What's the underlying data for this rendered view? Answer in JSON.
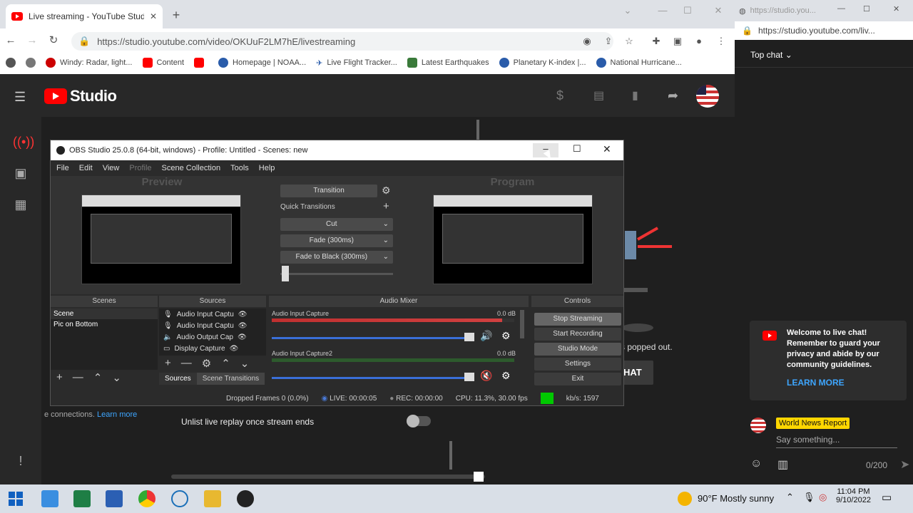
{
  "browser": {
    "tab_title": "Live streaming - YouTube Studio",
    "url": "https://studio.youtube.com/video/OKUuF2LM7hE/livestreaming",
    "bookmarks": [
      {
        "label": "Windy: Radar, light..."
      },
      {
        "label": "Content"
      },
      {
        "label": ""
      },
      {
        "label": "Homepage | NOAA..."
      },
      {
        "label": "Live Flight Tracker..."
      },
      {
        "label": "Latest Earthquakes"
      },
      {
        "label": "Planetary K-index |..."
      },
      {
        "label": "National Hurricane..."
      }
    ]
  },
  "popup": {
    "tab_title": "https://studio.you...",
    "url": "https://studio.youtube.com/liv...",
    "chat_mode": "Top chat",
    "welcome_text": "Welcome to live chat! Remember to guard your privacy and abide by our community guidelines.",
    "learn_more": "LEARN MORE",
    "channel_name": "World News Report",
    "input_placeholder": "Say something...",
    "char_count": "0/200"
  },
  "studio": {
    "logo_text": "Studio",
    "popped_text": "s popped out.",
    "chat_button": "HAT",
    "connections_text": "e connections.",
    "connections_link": "Learn more",
    "unlist_text": "Unlist live replay once stream ends"
  },
  "obs": {
    "title": "OBS Studio 25.0.8 (64-bit, windows) - Profile: Untitled - Scenes: new",
    "menu": [
      "File",
      "Edit",
      "View",
      "Profile",
      "Scene Collection",
      "Tools",
      "Help"
    ],
    "preview_label": "Preview",
    "program_label": "Program",
    "transition_label": "Transition",
    "quick_transitions": "Quick Transitions",
    "transitions": [
      "Cut",
      "Fade (300ms)",
      "Fade to Black (300ms)"
    ],
    "scenes_header": "Scenes",
    "scenes": [
      "Scene",
      "Pic on Bottom"
    ],
    "sources_header": "Sources",
    "sources": [
      "Audio Input Captu",
      "Audio Input Captu",
      "Audio Output Cap",
      "Display Capture"
    ],
    "tab_sources": "Sources",
    "tab_scene_transitions": "Scene Transitions",
    "mixer_header": "Audio Mixer",
    "mixer_channels": [
      {
        "name": "Audio Input Capture",
        "db": "0.0 dB"
      },
      {
        "name": "Audio Input Capture2",
        "db": "0.0 dB"
      }
    ],
    "controls_header": "Controls",
    "controls": [
      "Stop Streaming",
      "Start Recording",
      "Studio Mode",
      "Settings",
      "Exit"
    ],
    "status": {
      "dropped": "Dropped Frames 0 (0.0%)",
      "live": "LIVE: 00:00:05",
      "rec": "REC: 00:00:00",
      "cpu": "CPU: 11.3%, 30.00 fps",
      "kbps": "kb/s: 1597"
    }
  },
  "taskbar": {
    "weather": "90°F  Mostly sunny",
    "time": "11:04 PM",
    "date": "9/10/2022"
  },
  "colors": {
    "yt_red": "#ff0000",
    "accent_blue": "#3ea6ff",
    "live_green": "#00c800",
    "badge_yellow": "#ffd600"
  }
}
